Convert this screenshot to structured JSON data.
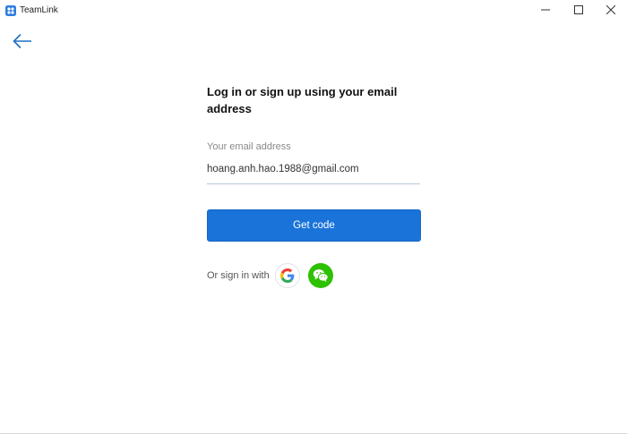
{
  "window": {
    "title": "TeamLink",
    "controls": [
      "minimize-icon",
      "maximize-icon",
      "close-icon"
    ]
  },
  "back": {
    "icon": "arrow-left-icon"
  },
  "login": {
    "heading": "Log in or sign up using your email address",
    "email_label": "Your email address",
    "email_value": "hoang.anh.hao.1988@gmail.com",
    "get_code_label": "Get code",
    "or_sign_in_label": "Or sign in with",
    "providers": [
      {
        "name": "Google",
        "icon": "google-icon"
      },
      {
        "name": "WeChat",
        "icon": "wechat-icon"
      }
    ]
  },
  "colors": {
    "accent": "#1a73d9",
    "back_arrow": "#1f6fc5",
    "wechat": "#2dc100",
    "app_icon": "#2f7de1"
  }
}
